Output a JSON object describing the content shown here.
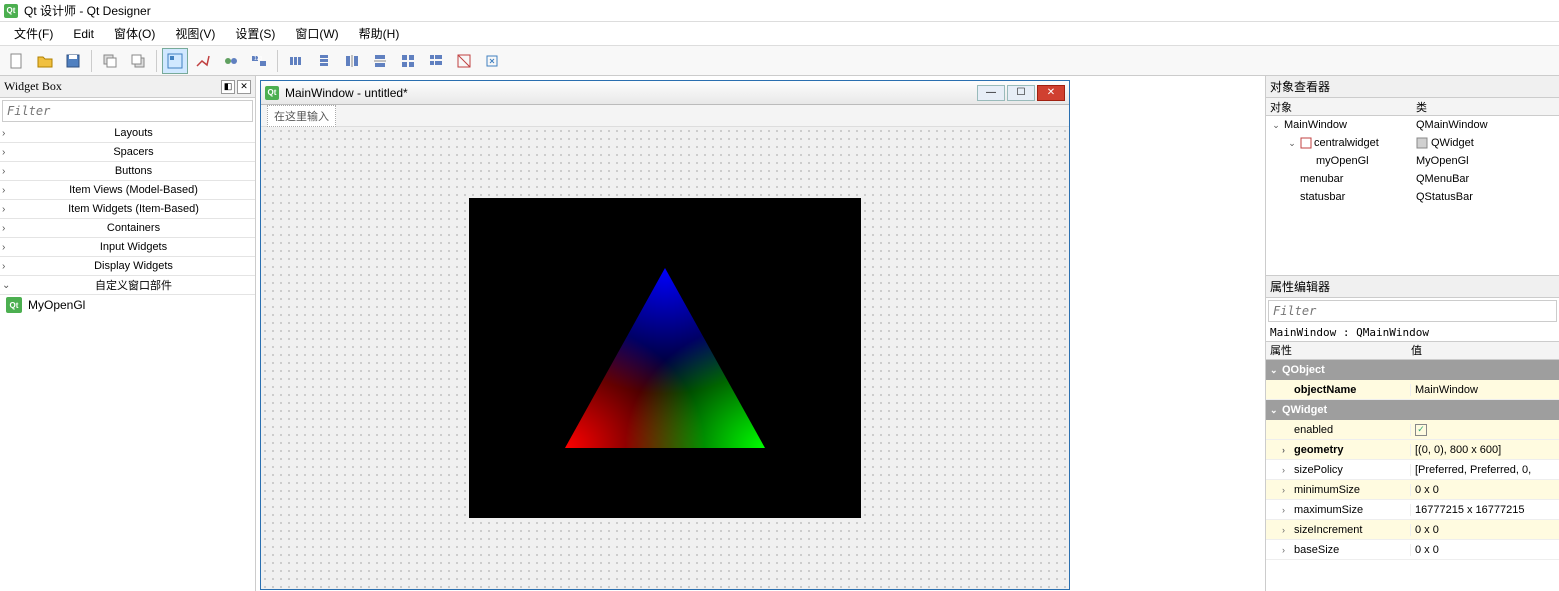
{
  "app": {
    "title": "Qt 设计师 - Qt Designer"
  },
  "menu": {
    "file": "文件(F)",
    "edit": "Edit",
    "form": "窗体(O)",
    "view": "视图(V)",
    "settings": "设置(S)",
    "window": "窗口(W)",
    "help": "帮助(H)"
  },
  "widgetbox": {
    "title": "Widget Box",
    "filter_placeholder": "Filter",
    "categories": [
      "Layouts",
      "Spacers",
      "Buttons",
      "Item Views (Model-Based)",
      "Item Widgets (Item-Based)",
      "Containers",
      "Input Widgets",
      "Display Widgets",
      "自定义窗口部件"
    ],
    "custom_item": "MyOpenGl"
  },
  "form": {
    "title": "MainWindow - untitled*",
    "menu_hint": "在这里输入"
  },
  "inspector": {
    "title": "对象查看器",
    "col_object": "对象",
    "col_class": "类",
    "rows": [
      {
        "indent": 0,
        "expand": "v",
        "name": "MainWindow",
        "cls": "QMainWindow",
        "icon": "win"
      },
      {
        "indent": 1,
        "expand": "v",
        "name": "centralwidget",
        "cls": "QWidget",
        "icon": "layout"
      },
      {
        "indent": 2,
        "expand": "",
        "name": "myOpenGl",
        "cls": "MyOpenGl",
        "icon": ""
      },
      {
        "indent": 1,
        "expand": "",
        "name": "menubar",
        "cls": "QMenuBar",
        "icon": ""
      },
      {
        "indent": 1,
        "expand": "",
        "name": "statusbar",
        "cls": "QStatusBar",
        "icon": ""
      }
    ]
  },
  "propeditor": {
    "title": "属性编辑器",
    "filter_placeholder": "Filter",
    "context": "MainWindow : QMainWindow",
    "col_prop": "属性",
    "col_value": "值",
    "groups": [
      {
        "name": "QObject",
        "rows": [
          {
            "name": "objectName",
            "value": "MainWindow",
            "bold": true,
            "yellow": true,
            "exp": ""
          }
        ]
      },
      {
        "name": "QWidget",
        "rows": [
          {
            "name": "enabled",
            "value": "checkbox",
            "yellow": true,
            "exp": ""
          },
          {
            "name": "geometry",
            "value": "[(0, 0), 800 x 600]",
            "bold": true,
            "yellow": true,
            "exp": "›"
          },
          {
            "name": "sizePolicy",
            "value": "[Preferred, Preferred, 0,",
            "yellow": false,
            "exp": "›"
          },
          {
            "name": "minimumSize",
            "value": "0 x 0",
            "yellow": true,
            "exp": "›"
          },
          {
            "name": "maximumSize",
            "value": "16777215 x 16777215",
            "yellow": false,
            "exp": "›"
          },
          {
            "name": "sizeIncrement",
            "value": "0 x 0",
            "yellow": true,
            "exp": "›"
          },
          {
            "name": "baseSize",
            "value": "0 x 0",
            "yellow": false,
            "exp": "›"
          }
        ]
      }
    ]
  }
}
